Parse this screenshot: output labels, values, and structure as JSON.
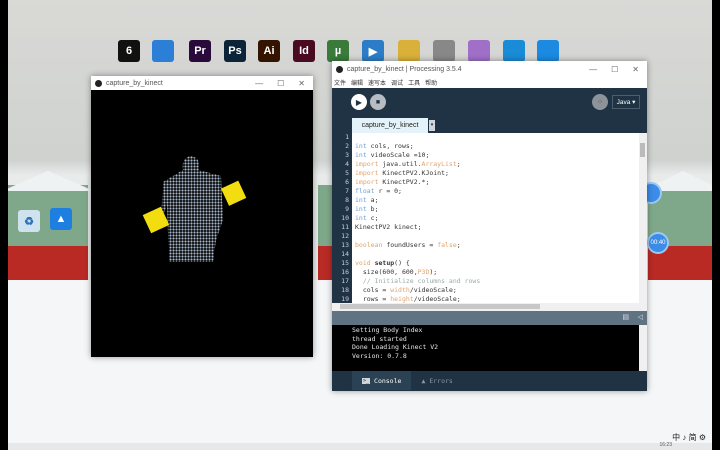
{
  "desktop": {
    "icons": [
      {
        "label": "6",
        "color": "#111"
      },
      {
        "label": "",
        "color": "#2b7fd6"
      },
      {
        "label": "Pr",
        "color": "#2a0a3a"
      },
      {
        "label": "Ps",
        "color": "#0b2438"
      },
      {
        "label": "Ai",
        "color": "#331400"
      },
      {
        "label": "Id",
        "color": "#4a0a22"
      },
      {
        "label": "µ",
        "color": "#3a7a3a"
      },
      {
        "label": "▶",
        "color": "#2c7cc8"
      },
      {
        "label": "",
        "color": "#d9b13a"
      },
      {
        "label": "",
        "color": "#888888"
      },
      {
        "label": "",
        "color": "#a070c8"
      },
      {
        "label": "",
        "color": "#1a8bd6"
      },
      {
        "label": "",
        "color": "#1b8ae0"
      }
    ],
    "timer_bubble": "00:40",
    "tray": "中 ♪ 简 ⚙",
    "clock": "16:23"
  },
  "sketch_window": {
    "title": "capture_by_kinect"
  },
  "ide": {
    "title": "capture_by_kinect | Processing 3.5.4",
    "menu": [
      "文件",
      "编辑",
      "速写本",
      "调试",
      "工具",
      "帮助"
    ],
    "mode": "Java ▾",
    "tab": "capture_by_kinect",
    "code": [
      [
        [
          "",
          ""
        ]
      ],
      [
        [
          "int",
          "ty"
        ],
        [
          " cols, rows;",
          "tx"
        ]
      ],
      [
        [
          "int",
          "ty"
        ],
        [
          " videoScale =10;",
          "tx"
        ]
      ],
      [
        [
          "import",
          "kw"
        ],
        [
          " java.util.",
          "tx"
        ],
        [
          "ArrayList",
          "kw"
        ],
        [
          ";",
          "tx"
        ]
      ],
      [
        [
          "import",
          "kw"
        ],
        [
          " KinectPV2.KJoint;",
          "tx"
        ]
      ],
      [
        [
          "import",
          "kw"
        ],
        [
          " KinectPV2.*;",
          "tx"
        ]
      ],
      [
        [
          "float",
          "ty"
        ],
        [
          " r = 0;",
          "tx"
        ]
      ],
      [
        [
          "int",
          "ty"
        ],
        [
          " a;",
          "tx"
        ]
      ],
      [
        [
          "int",
          "ty"
        ],
        [
          " b;",
          "tx"
        ]
      ],
      [
        [
          "int",
          "ty"
        ],
        [
          " c;",
          "tx"
        ]
      ],
      [
        [
          "KinectPV2 kinect;",
          "tx"
        ]
      ],
      [
        [
          "",
          ""
        ]
      ],
      [
        [
          "boolean",
          "kw"
        ],
        [
          " foundUsers = ",
          "tx"
        ],
        [
          "false",
          "kw"
        ],
        [
          ";",
          "tx"
        ]
      ],
      [
        [
          "",
          ""
        ]
      ],
      [
        [
          "void",
          "kw"
        ],
        [
          " ",
          "tx"
        ],
        [
          "setup",
          "fn"
        ],
        [
          "() {",
          "tx"
        ]
      ],
      [
        [
          "  size(600, 600,",
          "tx"
        ],
        [
          "P3D",
          "kw"
        ],
        [
          ");",
          "tx"
        ]
      ],
      [
        [
          "  // Initialize columns and rows",
          "cm"
        ]
      ],
      [
        [
          "  cols = ",
          "tx"
        ],
        [
          "width",
          "kw"
        ],
        [
          "/videoScale;",
          "tx"
        ]
      ],
      [
        [
          "  rows = ",
          "tx"
        ],
        [
          "height",
          "kw"
        ],
        [
          "/videoScale;",
          "tx"
        ]
      ]
    ],
    "console": [
      "Setting Body Index",
      "thread started",
      "Done Loading Kinect V2",
      "Version: 0.7.8"
    ],
    "bottom_tabs": {
      "console": "Console",
      "errors": "Errors"
    }
  }
}
